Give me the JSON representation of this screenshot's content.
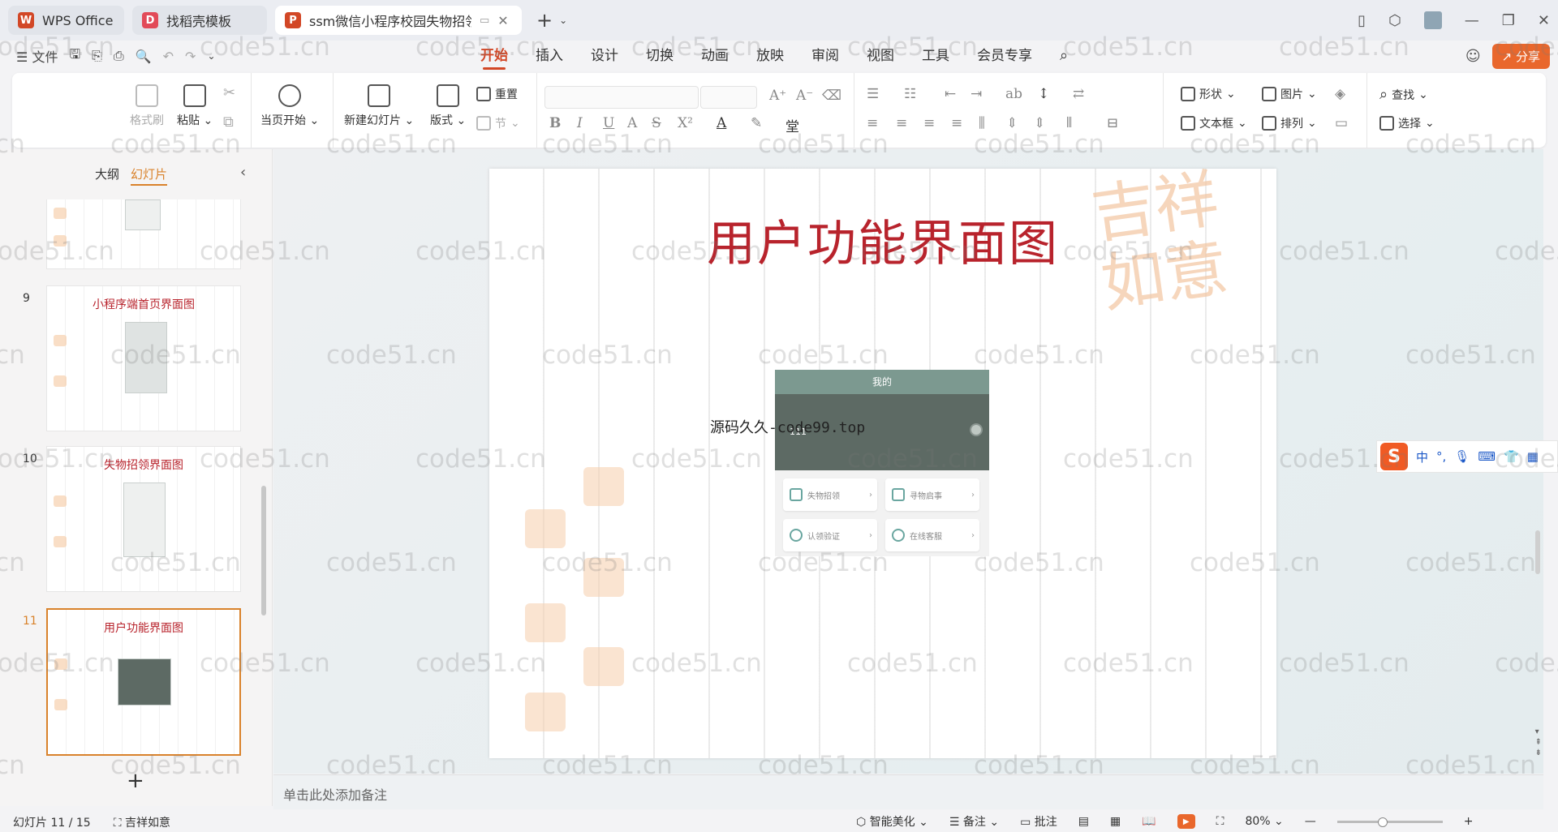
{
  "tabs": [
    {
      "label": "WPS Office",
      "icon": "wps-icon",
      "color": "#d24726"
    },
    {
      "label": "找稻壳模板",
      "icon": "docer-icon",
      "color": "#e24a58"
    },
    {
      "label": "ssm微信小程序校园失物招领",
      "icon": "ppt-icon",
      "color": "#d24726"
    }
  ],
  "menu": {
    "file": "文件",
    "ribbon_tabs": [
      "开始",
      "插入",
      "设计",
      "切换",
      "动画",
      "放映",
      "审阅",
      "视图",
      "工具",
      "会员专享"
    ],
    "active_tab": "开始",
    "share": "分享"
  },
  "ribbon": {
    "format_painter": "格式刷",
    "paste": "粘贴",
    "from_current": "当页开始",
    "new_slide": "新建幻灯片",
    "layout": "版式",
    "reset": "重置",
    "section": "节",
    "shape": "形状",
    "picture": "图片",
    "find": "查找",
    "textbox": "文本框",
    "arrange": "排列",
    "select": "选择"
  },
  "left_panel": {
    "tab_outline": "大纲",
    "tab_slides": "幻灯片",
    "thumbnails": [
      {
        "number": "",
        "title": ""
      },
      {
        "number": "9",
        "title": "小程序端首页界面图"
      },
      {
        "number": "10",
        "title": "失物招领界面图"
      },
      {
        "number": "11",
        "title": "用户功能界面图",
        "selected": true
      }
    ]
  },
  "slide": {
    "title": "用户功能界面图",
    "calligraphy": "吉祥如意",
    "overlay_text": "源码久久-code99.top",
    "phone": {
      "header": "我的",
      "username": "111",
      "cards": [
        "失物招领",
        "寻物启事",
        "认领验证",
        "在线客服"
      ]
    }
  },
  "ime": {
    "lang": "中",
    "punct": "°,"
  },
  "notes_placeholder": "单击此处添加备注",
  "status": {
    "slide_counter": "幻灯片 11 / 15",
    "theme": "吉祥如意",
    "beautify": "智能美化",
    "notes": "备注",
    "comments": "批注",
    "zoom": "80%"
  },
  "watermark": "code51.cn"
}
